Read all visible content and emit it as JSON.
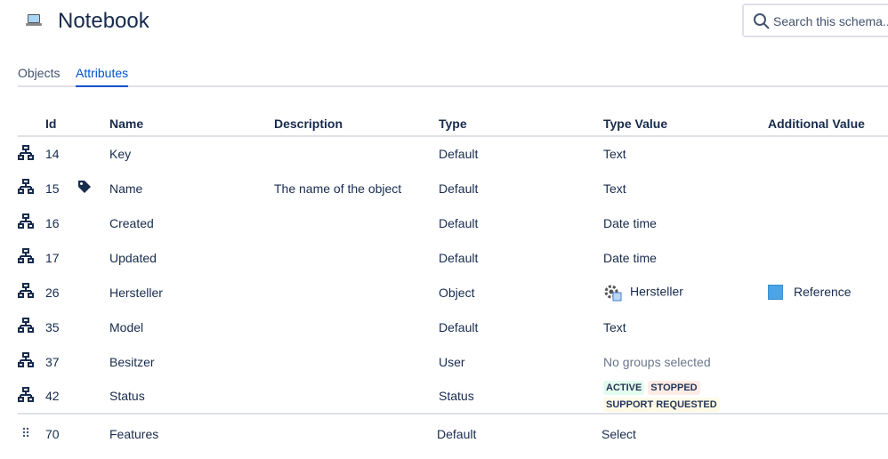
{
  "header": {
    "title": "Notebook",
    "icon": "laptop-icon",
    "search_placeholder": "Search this schema..."
  },
  "tabs": [
    {
      "label": "Objects",
      "active": false
    },
    {
      "label": "Attributes",
      "active": true
    }
  ],
  "columns": {
    "id": "Id",
    "name": "Name",
    "description": "Description",
    "type": "Type",
    "type_value": "Type Value",
    "additional_value": "Additional Value"
  },
  "rows": [
    {
      "id": "14",
      "name": "Key",
      "description": "",
      "type": "Default",
      "type_value": "Text",
      "additional": ""
    },
    {
      "id": "15",
      "name": "Name",
      "description": "The name of the object",
      "type": "Default",
      "type_value": "Text",
      "additional": "",
      "label_icon": true
    },
    {
      "id": "16",
      "name": "Created",
      "description": "",
      "type": "Default",
      "type_value": "Date time",
      "additional": ""
    },
    {
      "id": "17",
      "name": "Updated",
      "description": "",
      "type": "Default",
      "type_value": "Date time",
      "additional": ""
    },
    {
      "id": "26",
      "name": "Hersteller",
      "description": "",
      "type": "Object",
      "type_value": "Hersteller",
      "additional": "Reference",
      "additional_color": "#4ba3e8"
    },
    {
      "id": "35",
      "name": "Model",
      "description": "",
      "type": "Default",
      "type_value": "Text",
      "additional": ""
    },
    {
      "id": "37",
      "name": "Besitzer",
      "description": "",
      "type": "User",
      "type_value": "No groups selected",
      "additional": ""
    },
    {
      "id": "42",
      "name": "Status",
      "description": "",
      "type": "Status",
      "type_value": "",
      "additional": "",
      "statuses": [
        "ACTIVE",
        "STOPPED",
        "SUPPORT REQUESTED"
      ]
    },
    {
      "id": "70",
      "name": "Features",
      "description": "",
      "type": "Default",
      "type_value": "Select",
      "additional": ""
    }
  ]
}
